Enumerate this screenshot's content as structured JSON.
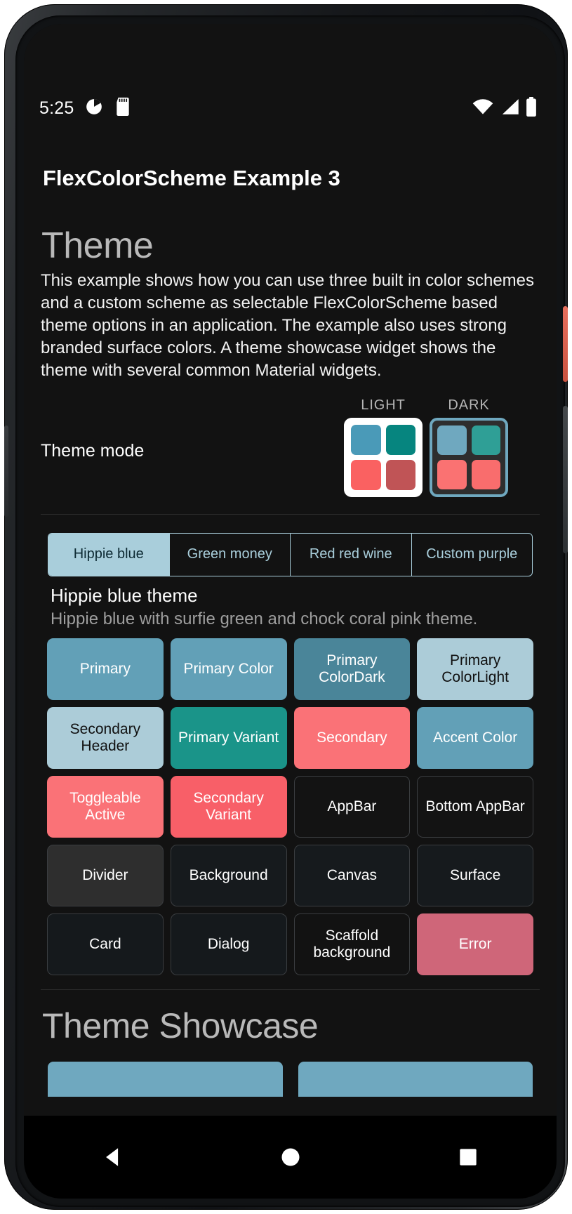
{
  "status_bar": {
    "clock": "5:25",
    "left_icons": [
      "pie-clock-icon",
      "sd-card-icon"
    ],
    "right_icons": [
      "wifi-icon",
      "cellular-signal-icon",
      "battery-icon"
    ]
  },
  "app_bar": {
    "title": "FlexColorScheme Example 3"
  },
  "theme_section": {
    "heading": "Theme",
    "description": "This example shows how you can use three built in color schemes and a custom scheme as selectable FlexColorScheme based theme options in an application. The example also uses strong branded surface colors. A theme showcase widget shows the theme with several common Material widgets.",
    "mode_label": "Theme mode",
    "modes": [
      {
        "caption": "LIGHT",
        "selected": false,
        "swatches": [
          "#4a9ab8",
          "#06857f",
          "#fa6161",
          "#c05456"
        ]
      },
      {
        "caption": "DARK",
        "selected": true,
        "swatches": [
          "#6fa8bf",
          "#2f9f96",
          "#fa7272",
          "#f96d6d"
        ]
      }
    ]
  },
  "scheme_tabs": {
    "selected_index": 0,
    "items": [
      {
        "label": "Hippie blue"
      },
      {
        "label": "Green money"
      },
      {
        "label": "Red red wine"
      },
      {
        "label": "Custom purple"
      }
    ]
  },
  "scheme_info": {
    "title": "Hippie blue theme",
    "subtitle": "Hippie blue with surfie green and chock coral pink theme."
  },
  "color_cards": [
    {
      "label": "Primary",
      "bg": "#62a0b7",
      "fg": "#ffffff",
      "bordered": false
    },
    {
      "label": "Primary Color",
      "bg": "#62a0b7",
      "fg": "#ffffff",
      "bordered": false
    },
    {
      "label": "Primary ColorDark",
      "bg": "#4a8599",
      "fg": "#ffffff",
      "bordered": false
    },
    {
      "label": "Primary ColorLight",
      "bg": "#acccd8",
      "fg": "#101010",
      "bordered": false
    },
    {
      "label": "Secondary Header",
      "bg": "#acccd8",
      "fg": "#101010",
      "bordered": false
    },
    {
      "label": "Primary Variant",
      "bg": "#1a9489",
      "fg": "#ffffff",
      "bordered": false
    },
    {
      "label": "Secondary",
      "bg": "#fa7277",
      "fg": "#ffffff",
      "bordered": false
    },
    {
      "label": "Accent Color",
      "bg": "#62a0b7",
      "fg": "#ffffff",
      "bordered": false
    },
    {
      "label": "Toggleable Active",
      "bg": "#fa7277",
      "fg": "#ffffff",
      "bordered": false
    },
    {
      "label": "Secondary Variant",
      "bg": "#f85f68",
      "fg": "#ffffff",
      "bordered": false
    },
    {
      "label": "AppBar",
      "bg": "#131313",
      "fg": "#ffffff",
      "bordered": true
    },
    {
      "label": "Bottom AppBar",
      "bg": "#131313",
      "fg": "#ffffff",
      "bordered": true
    },
    {
      "label": "Divider",
      "bg": "#2e2e2e",
      "fg": "#ffffff",
      "bordered": true
    },
    {
      "label": "Background",
      "bg": "#161a1d",
      "fg": "#ffffff",
      "bordered": true
    },
    {
      "label": "Canvas",
      "bg": "#161a1d",
      "fg": "#ffffff",
      "bordered": true
    },
    {
      "label": "Surface",
      "bg": "#161a1d",
      "fg": "#ffffff",
      "bordered": true
    },
    {
      "label": "Card",
      "bg": "#15191c",
      "fg": "#ffffff",
      "bordered": true
    },
    {
      "label": "Dialog",
      "bg": "#15191c",
      "fg": "#ffffff",
      "bordered": true
    },
    {
      "label": "Scaffold background",
      "bg": "#121212",
      "fg": "#ffffff",
      "bordered": true
    },
    {
      "label": "Error",
      "bg": "#cf6679",
      "fg": "#ffffff",
      "bordered": false
    }
  ],
  "showcase": {
    "heading": "Theme Showcase",
    "button_color": "#6fa8bf"
  },
  "nav_bar": {
    "items": [
      {
        "name": "back-nav-button"
      },
      {
        "name": "home-nav-button"
      },
      {
        "name": "recents-nav-button"
      }
    ]
  }
}
